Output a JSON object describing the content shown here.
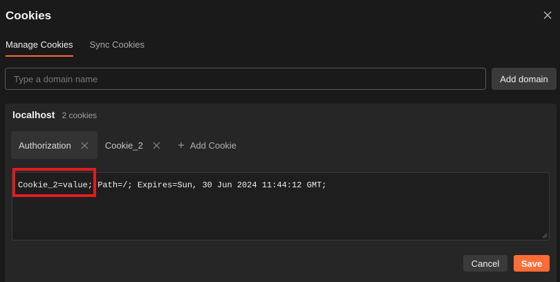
{
  "dialog": {
    "title": "Cookies",
    "close_icon": "close-icon"
  },
  "tabs": [
    {
      "label": "Manage Cookies",
      "active": true
    },
    {
      "label": "Sync Cookies",
      "active": false
    }
  ],
  "domain_input": {
    "placeholder": "Type a domain name",
    "value": ""
  },
  "add_domain_label": "Add domain",
  "domain": {
    "name": "localhost",
    "count_label": "2 cookies",
    "cookies": [
      {
        "name": "Authorization",
        "active": true
      },
      {
        "name": "Cookie_2",
        "active": false
      }
    ],
    "add_cookie_label": "Add Cookie",
    "cookie_value": "Cookie_2=value; Path=/; Expires=Sun, 30 Jun 2024 11:44:12 GMT;"
  },
  "actions": {
    "cancel_label": "Cancel",
    "save_label": "Save"
  },
  "colors": {
    "accent": "#ff6c37",
    "highlight": "#e11d1d",
    "background": "#1a1a1a",
    "panel": "#262626"
  }
}
